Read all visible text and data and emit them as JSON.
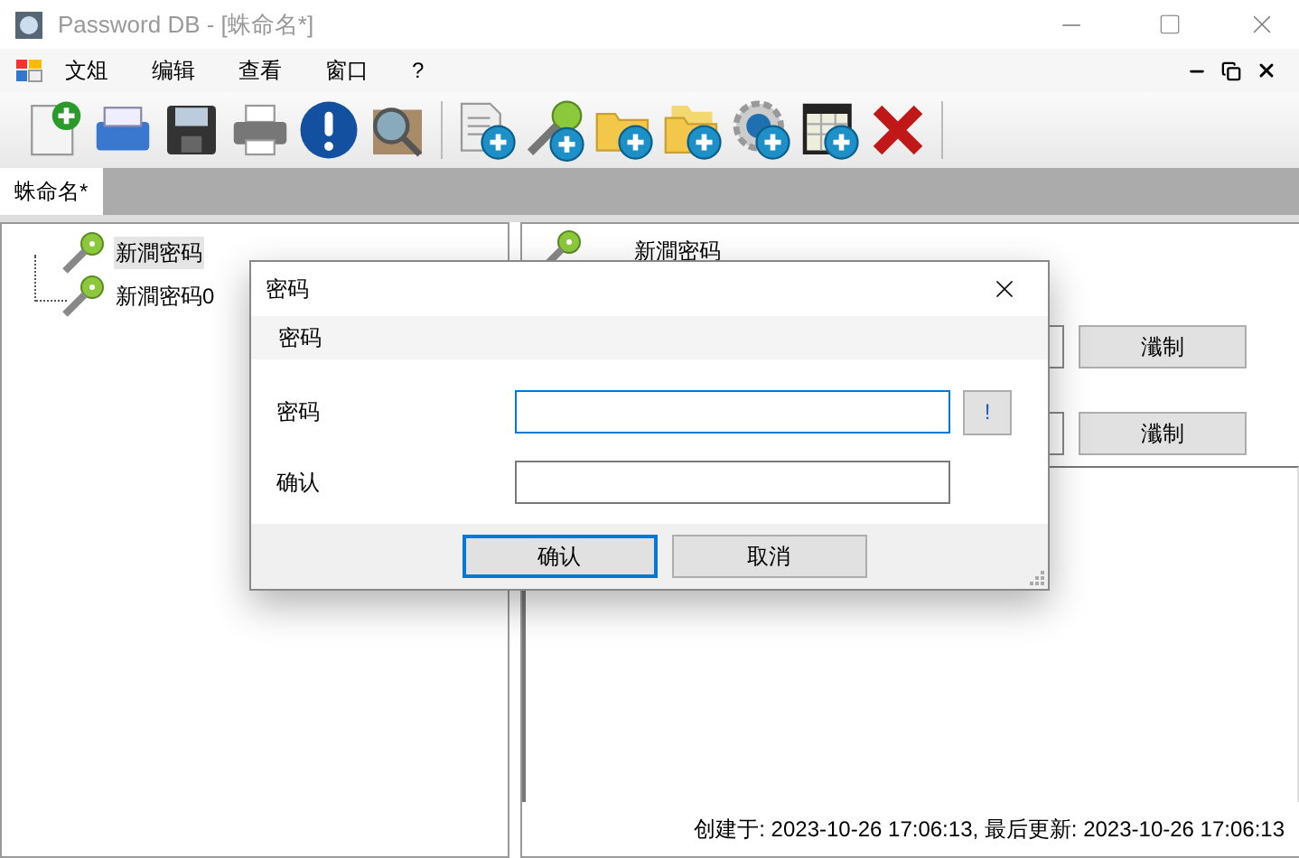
{
  "window": {
    "title": "Password DB - [蛛命名*]"
  },
  "menu": [
    "文俎",
    "编辑",
    "查看",
    "窗口",
    "?"
  ],
  "toolbar": [
    {
      "kind": "new"
    },
    {
      "kind": "open"
    },
    {
      "kind": "save"
    },
    {
      "kind": "print"
    },
    {
      "kind": "info"
    },
    {
      "kind": "find"
    },
    {
      "kind": "add-doc"
    },
    {
      "kind": "add-key"
    },
    {
      "kind": "add-folder"
    },
    {
      "kind": "add-subfolder"
    },
    {
      "kind": "add-setting"
    },
    {
      "kind": "add-table"
    },
    {
      "kind": "delete"
    }
  ],
  "tabs": [
    {
      "label": "蛛命名*",
      "selected": true
    }
  ],
  "tree": {
    "items": [
      {
        "label": "新澗密码",
        "selected": true
      },
      {
        "label": "新澗密码0",
        "selected": false
      }
    ]
  },
  "detail": {
    "title": "新澗密码",
    "buttons": [
      "瀸制",
      "瀸制"
    ],
    "status": "创建于: 2023-10-26 17:06:13, 最后更新: 2023-10-26 17:06:13"
  },
  "dialog": {
    "title": "密码",
    "header": "密码",
    "fields": [
      {
        "label": "密码",
        "focused": true,
        "has_reveal": true,
        "reveal_label": "!"
      },
      {
        "label": "确认",
        "focused": false,
        "has_reveal": false
      }
    ],
    "buttons": [
      {
        "label": "确认",
        "default": true
      },
      {
        "label": "取消",
        "default": false
      }
    ]
  }
}
